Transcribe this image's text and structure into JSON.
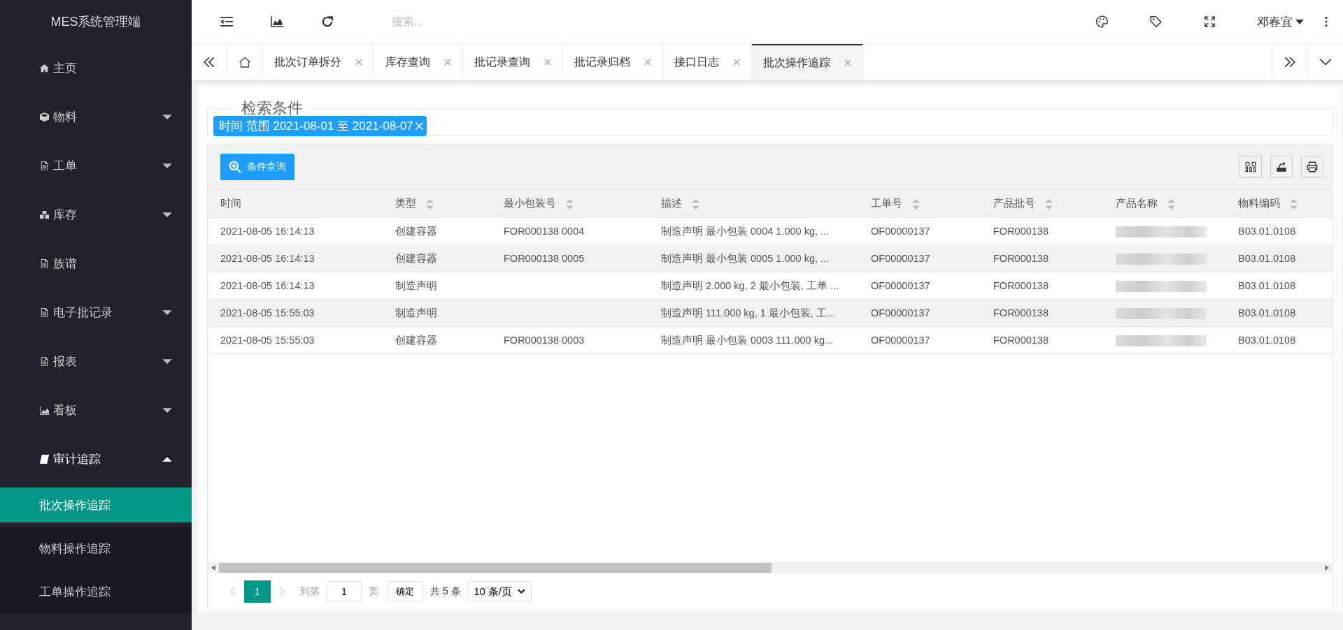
{
  "app": {
    "title": "MES系统管理端"
  },
  "header": {
    "search_placeholder": "搜索...",
    "user": "邓春宜"
  },
  "sidebar": {
    "items": [
      {
        "label": "主页"
      },
      {
        "label": "物料",
        "expanded": false
      },
      {
        "label": "工单",
        "expanded": false
      },
      {
        "label": "库存",
        "expanded": false
      },
      {
        "label": "族谱"
      },
      {
        "label": "电子批记录",
        "expanded": false
      },
      {
        "label": "报表",
        "expanded": false
      },
      {
        "label": "看板",
        "expanded": false
      },
      {
        "label": "审计追踪",
        "expanded": true,
        "children": [
          {
            "label": "批次操作追踪",
            "selected": true
          },
          {
            "label": "物料操作追踪",
            "selected": false
          },
          {
            "label": "工单操作追踪",
            "selected": false
          }
        ]
      }
    ]
  },
  "tabs": [
    {
      "label": "批次订单拆分",
      "selected": false
    },
    {
      "label": "库存查询",
      "selected": false
    },
    {
      "label": "批记录查询",
      "selected": false
    },
    {
      "label": "批记录归档",
      "selected": false
    },
    {
      "label": "接口日志",
      "selected": false
    },
    {
      "label": "批次操作追踪",
      "selected": true
    }
  ],
  "search_panel": {
    "legend": "检索条件",
    "filter_chip": "时间 范围 2021-08-01 至 2021-08-07"
  },
  "toolbar": {
    "query_button": "条件查询"
  },
  "table": {
    "columns": [
      {
        "label": "时间",
        "sortable": false
      },
      {
        "label": "类型",
        "sortable": true
      },
      {
        "label": "最小包装号",
        "sortable": true
      },
      {
        "label": "描述",
        "sortable": true
      },
      {
        "label": "工单号",
        "sortable": true
      },
      {
        "label": "产品批号",
        "sortable": true
      },
      {
        "label": "产品名称",
        "sortable": true
      },
      {
        "label": "物料编码",
        "sortable": true
      }
    ],
    "rows": [
      [
        "2021-08-05 16:14:13",
        "创建容器",
        "FOR000138 0004",
        "制造声明 最小包装 0004 1.000 kg, ...",
        "OF00000137",
        "FOR000138",
        "",
        "B03.01.0108"
      ],
      [
        "2021-08-05 16:14:13",
        "创建容器",
        "FOR000138 0005",
        "制造声明 最小包装 0005 1.000 kg, ...",
        "OF00000137",
        "FOR000138",
        "",
        "B03.01.0108"
      ],
      [
        "2021-08-05 16:14:13",
        "制造声明",
        "",
        "制造声明 2.000 kg, 2 最小包装, 工单 ...",
        "OF00000137",
        "FOR000138",
        "",
        "B03.01.0108"
      ],
      [
        "2021-08-05 15:55:03",
        "制造声明",
        "",
        "制造声明 111.000 kg, 1 最小包装, 工...",
        "OF00000137",
        "FOR000138",
        "",
        "B03.01.0108"
      ],
      [
        "2021-08-05 15:55:03",
        "创建容器",
        "FOR000138 0003",
        "制造声明 最小包装 0003 111.000 kg...",
        "OF00000137",
        "FOR000138",
        "",
        "B03.01.0108"
      ]
    ]
  },
  "pagination": {
    "pages": [
      {
        "label": "1",
        "selected": true
      }
    ],
    "goto_label": "到第",
    "goto_value": "1",
    "page_unit": "页",
    "confirm": "确定",
    "total": "共 5 条",
    "page_size": "10 条/页"
  }
}
